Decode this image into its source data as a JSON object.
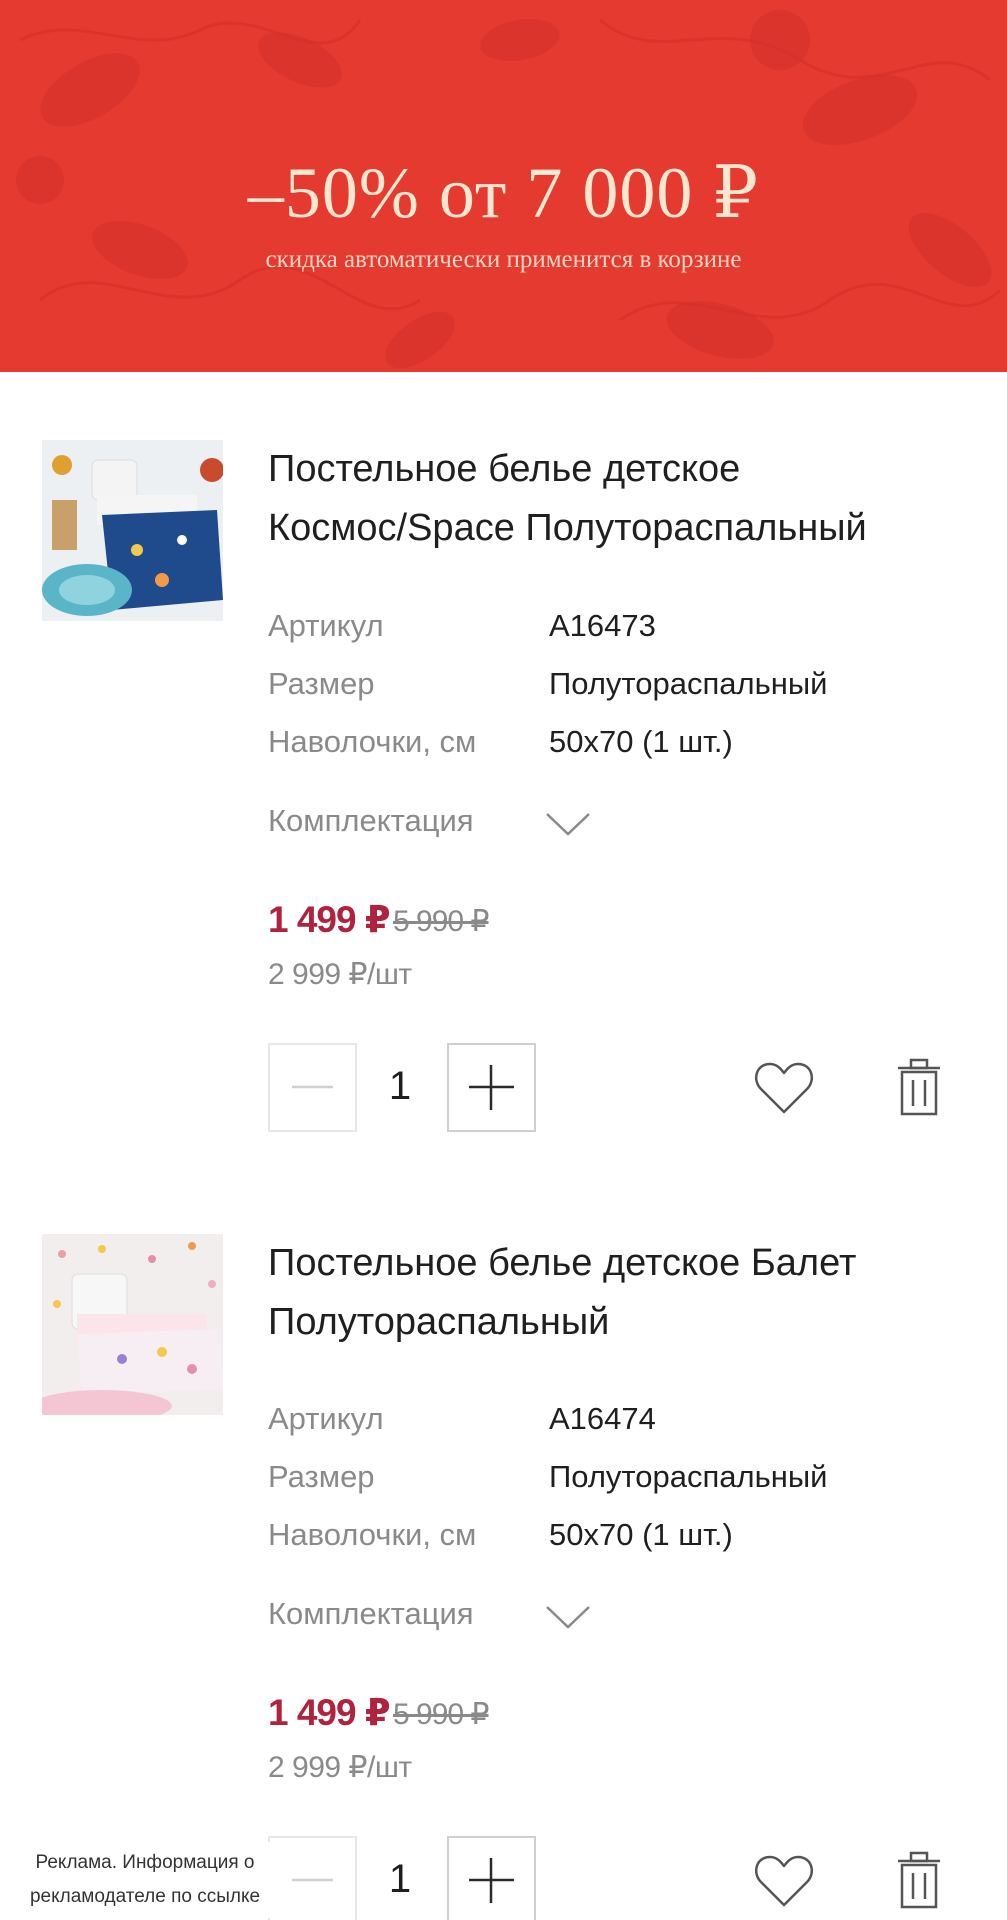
{
  "banner": {
    "title": "–50% от 7 000 ₽",
    "subtitle": "скидка автоматически применится в корзине",
    "background_color": "#e53a2f",
    "text_color": "#fbe6cf"
  },
  "products": [
    {
      "title_line1": "Постельное белье детское",
      "title_line2": "Космос/Space Полутораспальный",
      "specs": [
        {
          "label": "Артикул",
          "value": "A16473"
        },
        {
          "label": "Размер",
          "value": "Полутораспальный"
        },
        {
          "label": "Наволочки, см",
          "value": "50x70 (1 шт.)"
        }
      ],
      "kompl_label": "Комплектация",
      "price_new": "1 499 ₽",
      "price_old": "5 990 ₽",
      "price_unit": "2 999 ₽/шт",
      "quantity": "1"
    },
    {
      "title_line1": "Постельное белье детское Балет",
      "title_line2": "Полутораспальный",
      "specs": [
        {
          "label": "Артикул",
          "value": "A16474"
        },
        {
          "label": "Размер",
          "value": "Полутораспальный"
        },
        {
          "label": "Наволочки, см",
          "value": "50x70 (1 шт.)"
        }
      ],
      "kompl_label": "Комплектация",
      "price_new": "1 499 ₽",
      "price_old": "5 990 ₽",
      "price_unit": "2 999 ₽/шт",
      "quantity": "1"
    }
  ],
  "icons": {
    "minus": "minus-icon",
    "plus": "plus-icon",
    "favorite": "heart-icon",
    "delete": "trash-icon",
    "expand": "chevron-down-icon"
  },
  "colors": {
    "price_accent": "#b0233e",
    "muted_text": "#8a8a8a"
  },
  "ad_note": {
    "line1": "Реклама. Информация о",
    "line2": "рекламодателе по ссылке"
  }
}
